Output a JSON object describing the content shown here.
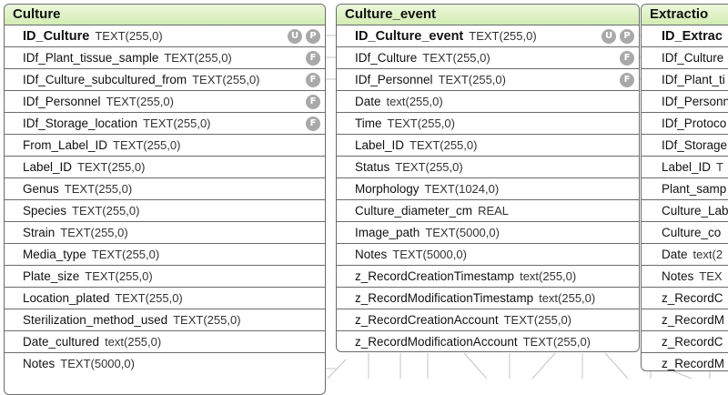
{
  "colors": {
    "header_top": "#ecf8dc",
    "header_bottom": "#d2ecb2",
    "border": "#6b6b6b",
    "badge": "#a9a9a9",
    "line": "#c4c4c4"
  },
  "tables": [
    {
      "name": "Culture",
      "fields": [
        {
          "name": "ID_Culture",
          "type": "TEXT(255,0)",
          "pk": true,
          "badges": [
            "U",
            "P"
          ]
        },
        {
          "name": "IDf_Plant_tissue_sample",
          "type": "TEXT(255,0)",
          "badges": [
            "F"
          ]
        },
        {
          "name": "IDf_Culture_subcultured_from",
          "type": "TEXT(255,0)",
          "badges": [
            "F"
          ]
        },
        {
          "name": "IDf_Personnel",
          "type": "TEXT(255,0)",
          "badges": [
            "F"
          ]
        },
        {
          "name": "IDf_Storage_location",
          "type": "TEXT(255,0)",
          "badges": [
            "F"
          ]
        },
        {
          "name": "From_Label_ID",
          "type": "TEXT(255,0)"
        },
        {
          "name": "Label_ID",
          "type": "TEXT(255,0)"
        },
        {
          "name": "Genus",
          "type": "TEXT(255,0)"
        },
        {
          "name": "Species",
          "type": "TEXT(255,0)"
        },
        {
          "name": "Strain",
          "type": "TEXT(255,0)"
        },
        {
          "name": "Media_type",
          "type": "TEXT(255,0)"
        },
        {
          "name": "Plate_size",
          "type": "TEXT(255,0)"
        },
        {
          "name": "Location_plated",
          "type": "TEXT(255,0)"
        },
        {
          "name": "Sterilization_method_used",
          "type": "TEXT(255,0)"
        },
        {
          "name": "Date_cultured",
          "type": "text(255,0)"
        },
        {
          "name": "Notes",
          "type": "TEXT(5000,0)"
        }
      ]
    },
    {
      "name": "Culture_event",
      "fields": [
        {
          "name": "ID_Culture_event",
          "type": "TEXT(255,0)",
          "pk": true,
          "badges": [
            "U",
            "P"
          ]
        },
        {
          "name": "IDf_Culture",
          "type": "TEXT(255,0)",
          "badges": [
            "F"
          ]
        },
        {
          "name": "IDf_Personnel",
          "type": "TEXT(255,0)",
          "badges": [
            "F"
          ]
        },
        {
          "name": "Date",
          "type": "text(255,0)"
        },
        {
          "name": "Time",
          "type": "TEXT(255,0)"
        },
        {
          "name": "Label_ID",
          "type": "TEXT(255,0)"
        },
        {
          "name": "Status",
          "type": "TEXT(255,0)"
        },
        {
          "name": "Morphology",
          "type": "TEXT(1024,0)"
        },
        {
          "name": "Culture_diameter_cm",
          "type": "REAL"
        },
        {
          "name": "Image_path",
          "type": "TEXT(5000,0)"
        },
        {
          "name": "Notes",
          "type": "TEXT(5000,0)"
        },
        {
          "name": "z_RecordCreationTimestamp",
          "type": "text(255,0)"
        },
        {
          "name": "z_RecordModificationTimestamp",
          "type": "text(255,0)"
        },
        {
          "name": "z_RecordCreationAccount",
          "type": "TEXT(255,0)"
        },
        {
          "name": "z_RecordModificationAccount",
          "type": "TEXT(255,0)"
        }
      ]
    },
    {
      "name": "Extractio",
      "fields": [
        {
          "name": "ID_Extrac",
          "type": "",
          "pk": true
        },
        {
          "name": "IDf_Culture",
          "type": ""
        },
        {
          "name": "IDf_Plant_ti",
          "type": ""
        },
        {
          "name": "IDf_Personn",
          "type": ""
        },
        {
          "name": "IDf_Protoco",
          "type": ""
        },
        {
          "name": "IDf_Storage",
          "type": ""
        },
        {
          "name": "Label_ID",
          "type": "T"
        },
        {
          "name": "Plant_samp",
          "type": ""
        },
        {
          "name": "Culture_Lab",
          "type": ""
        },
        {
          "name": "Culture_co",
          "type": ""
        },
        {
          "name": "Date",
          "type": "text(2"
        },
        {
          "name": "Notes",
          "type": "TEX"
        },
        {
          "name": "z_RecordC",
          "type": ""
        },
        {
          "name": "z_RecordM",
          "type": ""
        },
        {
          "name": "z_RecordC",
          "type": ""
        },
        {
          "name": "z_RecordM",
          "type": ""
        }
      ]
    }
  ]
}
